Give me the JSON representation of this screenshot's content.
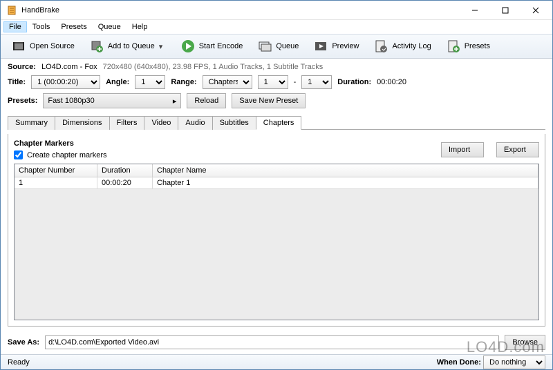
{
  "app": {
    "title": "HandBrake"
  },
  "menu": {
    "file": "File",
    "tools": "Tools",
    "presets": "Presets",
    "queue": "Queue",
    "help": "Help"
  },
  "toolbar": {
    "open_source": "Open Source",
    "add_queue": "Add to Queue",
    "start_encode": "Start Encode",
    "queue": "Queue",
    "preview": "Preview",
    "activity_log": "Activity Log",
    "presets": "Presets"
  },
  "source": {
    "label": "Source:",
    "name": "LO4D.com - Fox",
    "info": "720x480 (640x480), 23.98 FPS, 1 Audio Tracks, 1 Subtitle Tracks"
  },
  "title_row": {
    "title_label": "Title:",
    "title_value": "1 (00:00:20)",
    "angle_label": "Angle:",
    "angle_value": "1",
    "range_label": "Range:",
    "range_type": "Chapters",
    "range_from": "1",
    "range_dash": "-",
    "range_to": "1",
    "duration_label": "Duration:",
    "duration_value": "00:00:20"
  },
  "presets": {
    "label": "Presets:",
    "value": "Fast 1080p30",
    "reload": "Reload",
    "save_new": "Save New Preset"
  },
  "tabs": {
    "summary": "Summary",
    "dimensions": "Dimensions",
    "filters": "Filters",
    "video": "Video",
    "audio": "Audio",
    "subtitles": "Subtitles",
    "chapters": "Chapters"
  },
  "chapters": {
    "section_title": "Chapter Markers",
    "create_checkbox": "Create chapter markers",
    "import": "Import",
    "export": "Export",
    "cols": {
      "num": "Chapter Number",
      "dur": "Duration",
      "name": "Chapter Name"
    },
    "row": {
      "num": "1",
      "dur": "00:00:20",
      "name": "Chapter 1"
    }
  },
  "save_as": {
    "label": "Save As:",
    "value": "d:\\LO4D.com\\Exported Video.avi",
    "browse": "Browse"
  },
  "status": {
    "ready": "Ready",
    "when_done_label": "When Done:",
    "when_done_value": "Do nothing"
  },
  "watermark": "LO4D.com"
}
